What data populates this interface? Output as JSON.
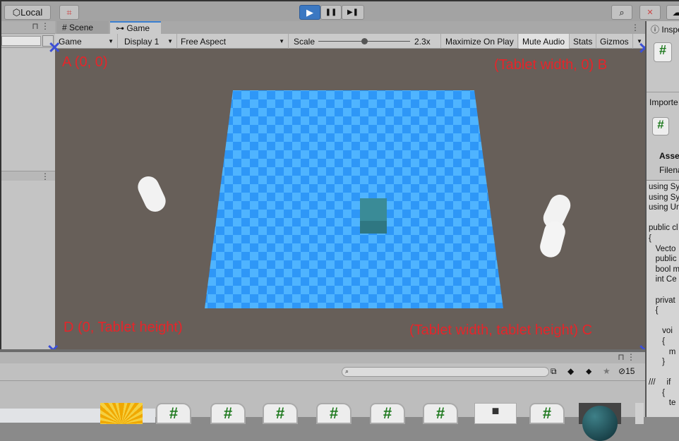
{
  "toolbar": {
    "local_label": "Local",
    "play": "▶",
    "pause": "❚❚",
    "step": "▶❚",
    "search_icon": "search-icon"
  },
  "hierarchy": {
    "lock": "🔒",
    "menu": "⋮"
  },
  "game_panel": {
    "tabs": [
      {
        "label": "Scene",
        "icon": "#"
      },
      {
        "label": "Game",
        "icon": "⊶"
      }
    ],
    "view_select": "Game",
    "display": "Display 1",
    "aspect": "Free Aspect",
    "scale_label": "Scale",
    "scale_value": "2.3x",
    "scale_fraction": 0.5,
    "maximize": "Maximize On Play",
    "mute": "Mute Audio",
    "stats": "Stats",
    "gizmos": "Gizmos"
  },
  "annotations": {
    "a": "A (0, 0)",
    "b": "(Tablet width, 0) B",
    "c": "(Tablet width, tablet height) C",
    "d": "D (0, Tablet height)",
    "marker": "✕"
  },
  "inspector": {
    "tab": "Inspe",
    "imported": "Importe",
    "assets": "Asse",
    "filename": "Filena",
    "code": "using Sy\nusing Sy\nusing Ur\n\npublic cl\n{\n   Vecto\n   public\n   bool m\n   int Ce\n\n   privat\n   {\n\n      voi\n      {\n         m\n      }\n\n///     if\n      {\n         te"
  },
  "project": {
    "hidden_count": "15",
    "asset_icon": "#"
  },
  "colors": {
    "viewport": "#675f59",
    "checker_a": "#2e97f7",
    "checker_b": "#4fb4ff",
    "annotation": "#e5252a",
    "marker": "#3c4fd6"
  }
}
